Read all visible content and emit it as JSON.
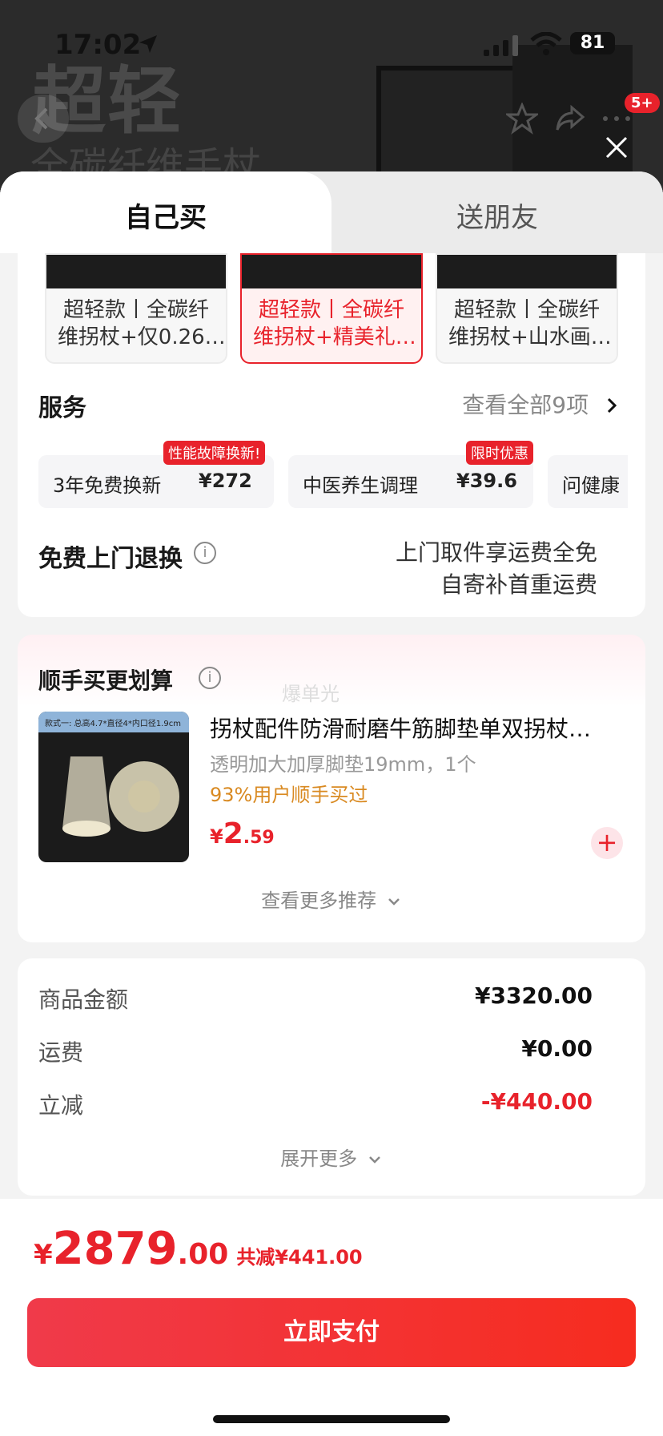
{
  "status": {
    "time": "17:02",
    "battery": "81"
  },
  "backdrop": {
    "big": "超轻",
    "sub": "全碳纤维手杖",
    "badge": "5+"
  },
  "tabs": {
    "self": "自己买",
    "gift": "送朋友"
  },
  "skus": [
    {
      "line1": "超轻款丨全碳纤",
      "line2": "维拐杖+仅0.26…",
      "selected": false
    },
    {
      "line1": "超轻款丨全碳纤",
      "line2": "维拐杖+精美礼…",
      "selected": true
    },
    {
      "line1": "超轻款丨全碳纤",
      "line2": "维拐杖+山水画…",
      "selected": false
    }
  ],
  "service": {
    "title": "服务",
    "view_all": "查看全部9项",
    "chips": [
      {
        "name": "3年免费换新",
        "price": "¥272",
        "tag": "性能故障换新!"
      },
      {
        "name": "中医养生调理",
        "price": "¥39.6",
        "tag": "限时优惠"
      },
      {
        "name": "问健康",
        "price": "",
        "tag": ""
      }
    ]
  },
  "return": {
    "title": "免费上门退换",
    "line1": "上门取件享运费全免",
    "line2": "自寄补首重运费"
  },
  "addon": {
    "title": "顺手买更划算",
    "ghost": "爆单光",
    "img_strip": "款式一: 总高4.7*直径4*内口径1.9cm",
    "name": "拐杖配件防滑耐磨牛筋脚垫单双拐杖…",
    "spec": "透明加大加厚脚垫19mm，1个",
    "rate": "93%用户顺手买过",
    "price_cur": "¥",
    "price_int": "2",
    "price_dec": ".59",
    "more": "查看更多推荐"
  },
  "summary": {
    "rows": [
      {
        "label": "商品金额",
        "value": "¥3320.00",
        "red": false
      },
      {
        "label": "运费",
        "value": "¥0.00",
        "red": false
      },
      {
        "label": "立减",
        "value": "-¥440.00",
        "red": true
      }
    ],
    "expand": "展开更多"
  },
  "bottom": {
    "cur": "¥",
    "int": "2879",
    "dec": ".00",
    "save": "共减¥441.00",
    "pay": "立即支付"
  },
  "colors": {
    "accent": "#e8222b",
    "pay_start": "#f03a4a",
    "pay_end": "#f62c1f",
    "rate": "#d98a22"
  }
}
